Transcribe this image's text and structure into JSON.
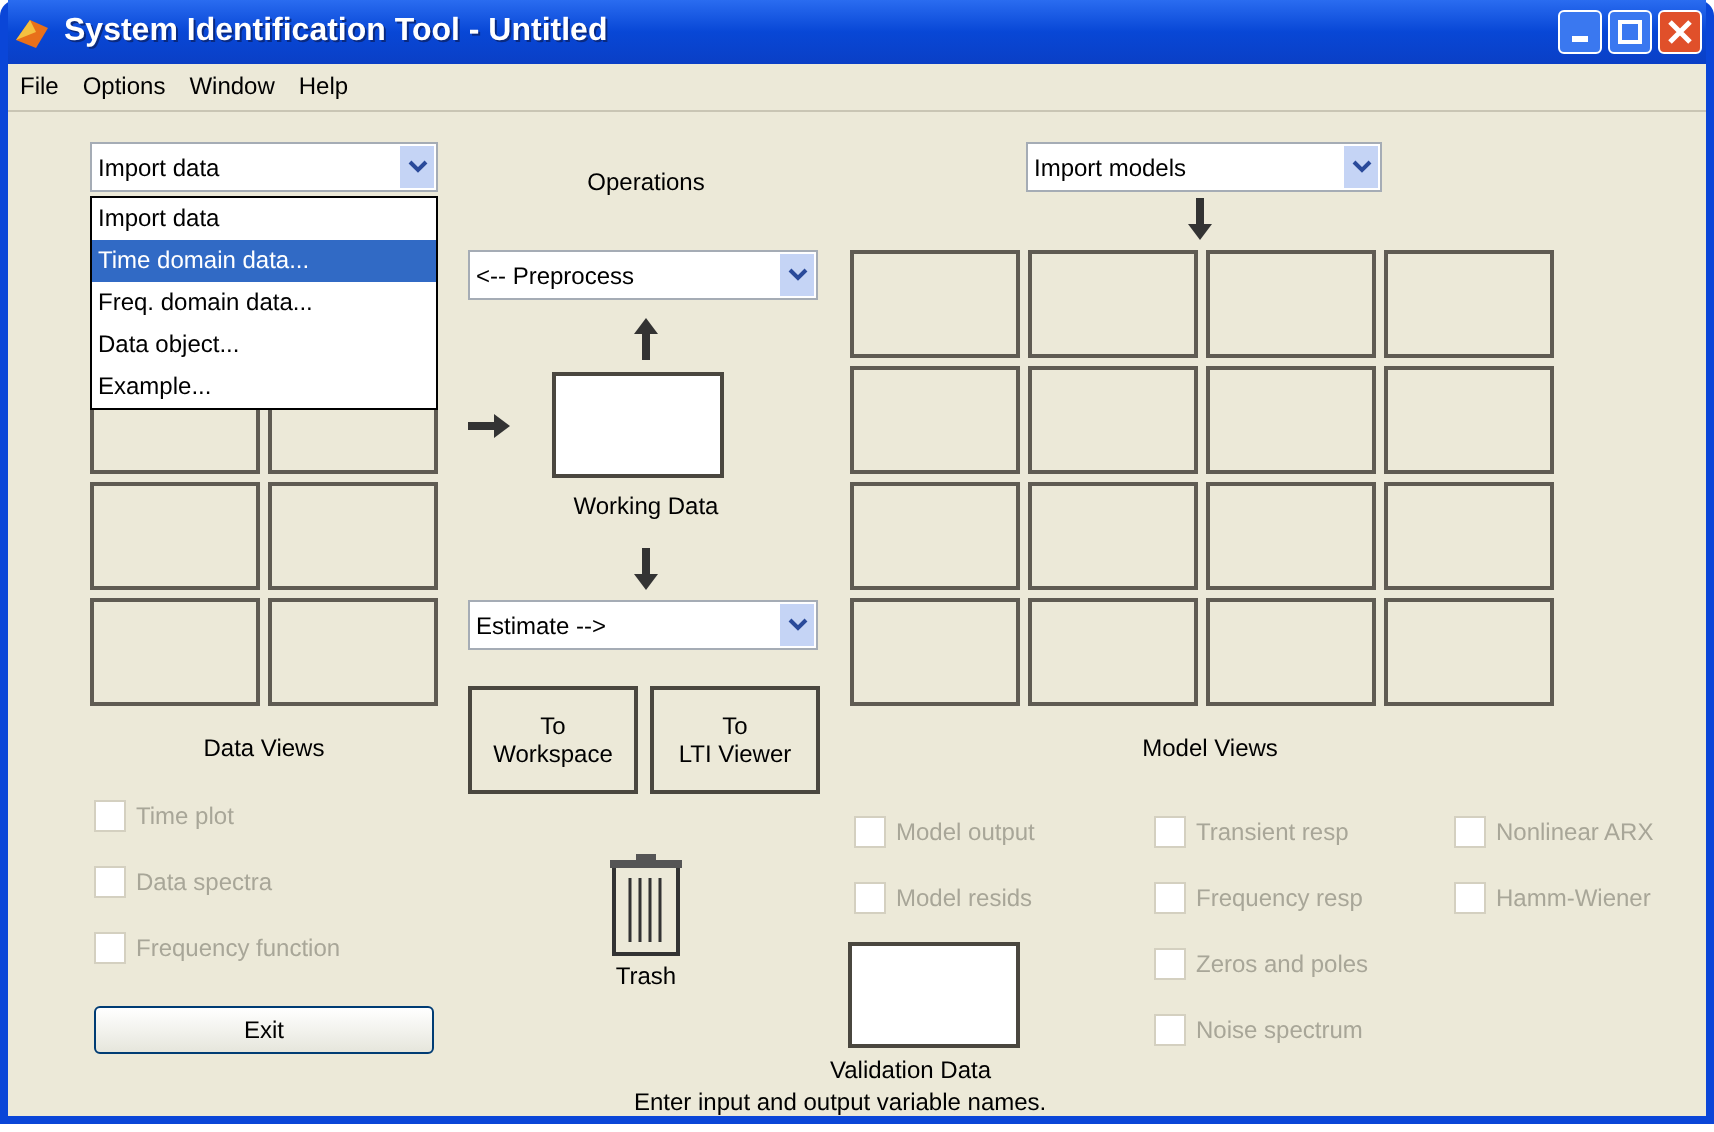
{
  "window": {
    "title": "System Identification Tool - Untitled"
  },
  "menu": [
    "File",
    "Options",
    "Window",
    "Help"
  ],
  "data_panel": {
    "import_select": {
      "value": "Import data"
    },
    "dropdown": [
      {
        "label": "Import data",
        "selected": false
      },
      {
        "label": "Time domain data...",
        "selected": true
      },
      {
        "label": "Freq. domain data...",
        "selected": false
      },
      {
        "label": "Data object...",
        "selected": false
      },
      {
        "label": "Example...",
        "selected": false
      }
    ],
    "label": "Data Views",
    "checks": [
      {
        "label": "Time plot",
        "checked": false,
        "disabled": true
      },
      {
        "label": "Data spectra",
        "checked": false,
        "disabled": true
      },
      {
        "label": "Frequency function",
        "checked": false,
        "disabled": true
      }
    ],
    "exit_button": "Exit"
  },
  "operations": {
    "label": "Operations",
    "preprocess_select": "<-- Preprocess",
    "working_data_label": "Working Data",
    "estimate_select": "Estimate -->",
    "buttons": [
      [
        "To",
        "Workspace"
      ],
      [
        "To",
        "LTI Viewer"
      ]
    ],
    "trash_label": "Trash",
    "hint": "Enter input and output variable names."
  },
  "model_panel": {
    "import_select": "Import models",
    "label": "Model Views",
    "columns": [
      [
        {
          "label": "Model output",
          "checked": false,
          "disabled": true
        },
        {
          "label": "Model resids",
          "checked": false,
          "disabled": true
        }
      ],
      [
        {
          "label": "Transient resp",
          "checked": false,
          "disabled": true
        },
        {
          "label": "Frequency resp",
          "checked": false,
          "disabled": true
        },
        {
          "label": "Zeros and poles",
          "checked": false,
          "disabled": true
        },
        {
          "label": "Noise spectrum",
          "checked": false,
          "disabled": true
        }
      ],
      [
        {
          "label": "Nonlinear ARX",
          "checked": false,
          "disabled": true
        },
        {
          "label": "Hamm-Wiener",
          "checked": false,
          "disabled": true
        }
      ]
    ],
    "validation_label": "Validation Data"
  }
}
